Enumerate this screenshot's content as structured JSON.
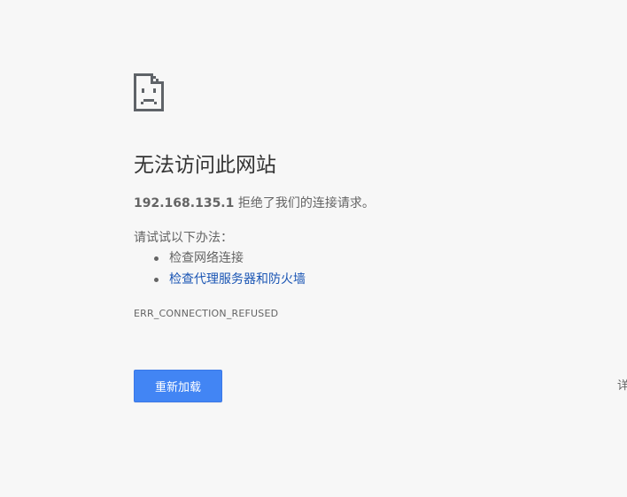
{
  "icon": "sad-page-icon",
  "title": "无法访问此网站",
  "summary": {
    "host": "192.168.135.1",
    "message": " 拒绝了我们的连接请求。"
  },
  "suggestions": {
    "heading": "请试试以下办法：",
    "items": [
      {
        "label": "检查网络连接"
      },
      {
        "label": "检查代理服务器和防火墙"
      }
    ]
  },
  "error_code": "ERR_CONNECTION_REFUSED",
  "buttons": {
    "reload_label": "重新加载",
    "details_label": "详"
  },
  "colors": {
    "background": "#f7f7f7",
    "title": "#333333",
    "text": "#646464",
    "link": "#1a55b4",
    "button": "#4285f4"
  }
}
